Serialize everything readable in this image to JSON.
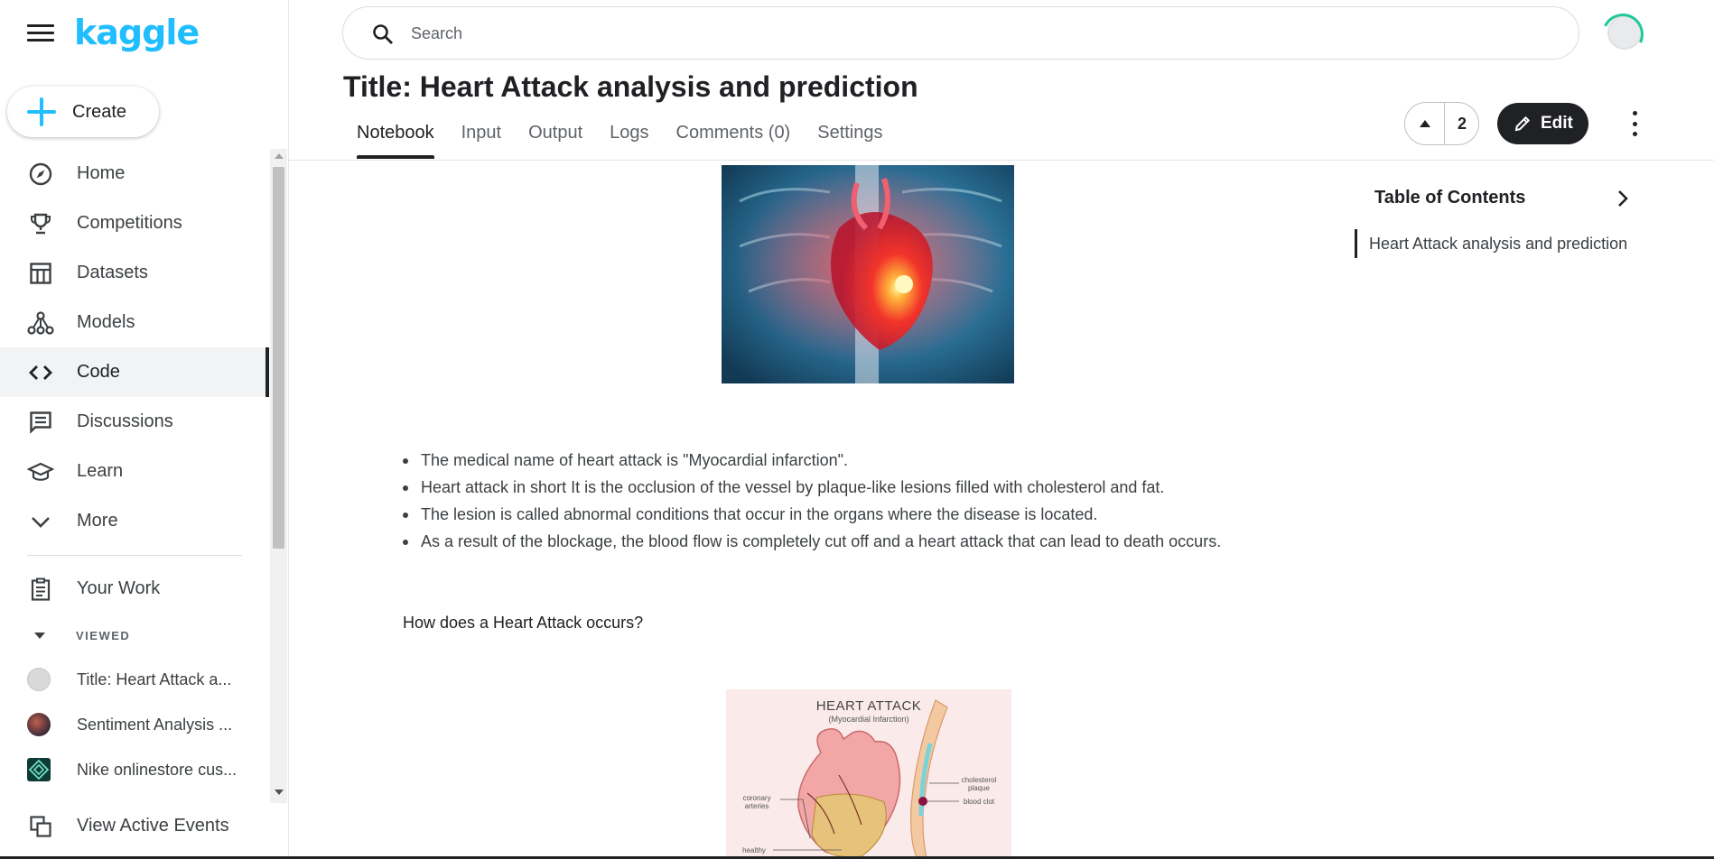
{
  "app": {
    "logo": "kaggle",
    "create_label": "Create"
  },
  "sidebar": {
    "items": [
      {
        "label": "Home",
        "icon": "compass-icon"
      },
      {
        "label": "Competitions",
        "icon": "trophy-icon"
      },
      {
        "label": "Datasets",
        "icon": "table-icon"
      },
      {
        "label": "Models",
        "icon": "models-icon"
      },
      {
        "label": "Code",
        "icon": "code-icon",
        "active": true
      },
      {
        "label": "Discussions",
        "icon": "discussion-icon"
      },
      {
        "label": "Learn",
        "icon": "graduation-cap-icon"
      },
      {
        "label": "More",
        "icon": "chevron-down-icon"
      }
    ],
    "your_work": "Your Work",
    "viewed_heading": "VIEWED",
    "recent": [
      {
        "label": "Title: Heart Attack a..."
      },
      {
        "label": "Sentiment Analysis ..."
      },
      {
        "label": "Nike onlinestore cus..."
      }
    ],
    "view_active_events": "View Active Events"
  },
  "search": {
    "placeholder": "Search"
  },
  "notebook": {
    "title": "Title: Heart Attack analysis and prediction",
    "tabs": [
      "Notebook",
      "Input",
      "Output",
      "Logs",
      "Comments (0)",
      "Settings"
    ],
    "active_tab": "Notebook",
    "vote_count": "2",
    "edit_label": "Edit"
  },
  "content": {
    "bullets": [
      "The medical name of heart attack is \"Myocardial infarction\".",
      "Heart attack in short It is the occlusion of the vessel by plaque-like lesions filled with cholesterol and fat.",
      "The lesion is called abnormal conditions that occur in the organs where the disease is located.",
      "As a result of the blockage, the blood flow is completely cut off and a heart attack that can lead to death occurs."
    ],
    "question": "How does a Heart Attack occurs?",
    "diagram": {
      "title": "HEART ATTACK",
      "subtitle": "(Myocardial Infarction)",
      "labels": {
        "coronary": "coronary arteries",
        "cholesterol": "cholesterol plaque",
        "clot": "blood clot",
        "healthy": "healthy"
      }
    }
  },
  "toc": {
    "title": "Table of Contents",
    "items": [
      "Heart Attack analysis and prediction"
    ]
  },
  "colors": {
    "brand": "#20beff",
    "dark": "#202124",
    "progress": "#20c997"
  }
}
